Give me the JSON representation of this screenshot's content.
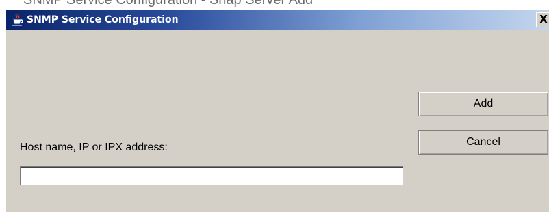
{
  "caption": "SNMP Service Configuration - Snap Server Add",
  "window": {
    "title": "SNMP Service Configuration",
    "close_label": "X",
    "app_icon": "java-cup-icon"
  },
  "buttons": {
    "add_label": "Add",
    "cancel_label": "Cancel"
  },
  "form": {
    "host_label": "Host name, IP or IPX address:",
    "host_value": "",
    "host_placeholder": ""
  },
  "colors": {
    "dialog_bg": "#d4d0c8",
    "title_gradient_start": "#0a246a",
    "title_gradient_end": "#c4d6ee",
    "title_text": "#ffffff"
  }
}
